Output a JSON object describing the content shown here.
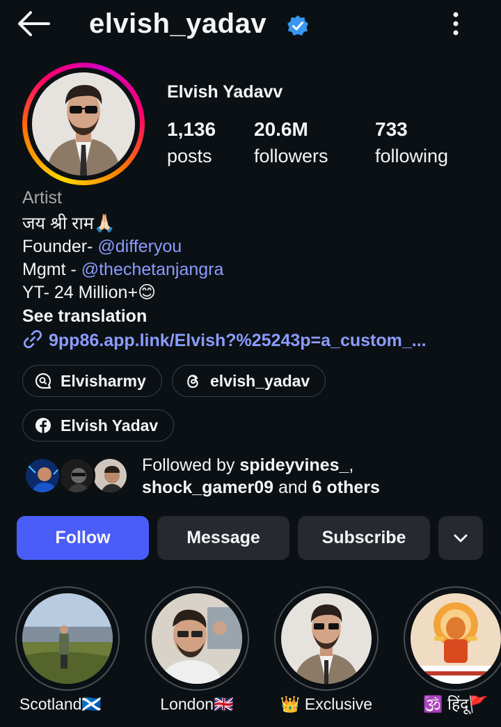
{
  "header": {
    "username": "elvish_yadav",
    "back_icon": "arrow-left-icon",
    "verified_icon": "verified-badge-icon",
    "menu_icon": "more-vertical-icon"
  },
  "profile": {
    "full_name": "Elvish Yadavv",
    "stats": {
      "posts_count": "1,136",
      "posts_label": "posts",
      "followers_count": "20.6M",
      "followers_label": "followers",
      "following_count": "733",
      "following_label": "following"
    }
  },
  "bio": {
    "category": "Artist",
    "line1": "जय श्री राम🙏🏻",
    "founder_prefix": "Founder- ",
    "founder_handle": "@differyou",
    "mgmt_prefix": "Mgmt - ",
    "mgmt_handle": "@thechetanjangra",
    "yt_line": "YT- 24 Million+😊",
    "see_translation": "See translation",
    "link_text": "9pp86.app.link/Elvish?%25243p=a_custom_..."
  },
  "chips": {
    "chip1": "Elvisharmy",
    "chip2": "elvish_yadav",
    "chip3": "Elvish Yadav"
  },
  "followed_by": {
    "prefix": "Followed by ",
    "user1": "spideyvines_",
    "sep": ",",
    "user2": "shock_gamer09",
    "and": " and ",
    "others": "6 others"
  },
  "actions": {
    "follow": "Follow",
    "message": "Message",
    "subscribe": "Subscribe"
  },
  "highlights": [
    {
      "label": "Scotland🏴󠁧󠁢󠁳󠁣󠁴󠁿"
    },
    {
      "label": "London🇬🇧"
    },
    {
      "label": "👑 Exclusive"
    },
    {
      "label": "🕉️ हिंदू🚩"
    }
  ],
  "colors": {
    "background": "#0b1014",
    "accent_button": "#4a5df9",
    "link": "#8b9cff",
    "verified": "#3897f0"
  }
}
